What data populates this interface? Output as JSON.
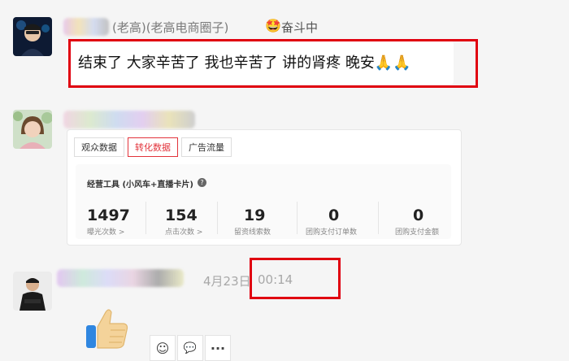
{
  "messages": [
    {
      "sender_suffix": "(老高)(老高电商圈子)",
      "status_emoji": "🤩",
      "status_text": "奋斗中",
      "text": "结束了 大家辛苦了 我也辛苦了 讲的肾疼 晚安🙏🙏"
    },
    {
      "card": {
        "tabs": [
          "观众数据",
          "转化数据",
          "广告流量"
        ],
        "section_title": "经营工具 (小风车+直播卡片)",
        "stats": [
          {
            "value": "1497",
            "label": "曝光次数 >"
          },
          {
            "value": "154",
            "label": "点击次数 >"
          },
          {
            "value": "19",
            "label": "留资线索数"
          },
          {
            "value": "0",
            "label": "团购支付订单数"
          },
          {
            "value": "0",
            "label": "团购支付金额"
          }
        ]
      }
    },
    {
      "date": "4月23日",
      "time": "00:14",
      "emoji": "👍"
    }
  ],
  "actions": [
    {
      "name": "add-emoji-icon",
      "glyph": "☺"
    },
    {
      "name": "quote-icon",
      "glyph": "💬"
    },
    {
      "name": "more-icon",
      "glyph": "···"
    }
  ]
}
